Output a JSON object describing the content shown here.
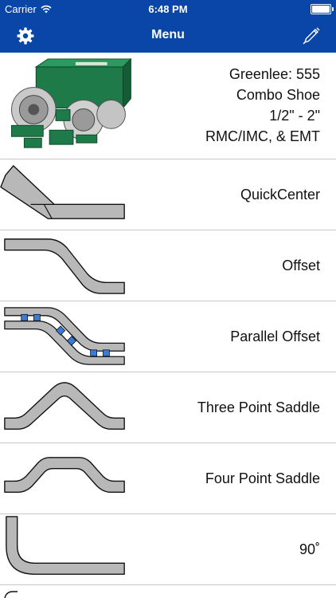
{
  "status_bar": {
    "carrier": "Carrier",
    "time": "6:48 PM"
  },
  "nav": {
    "title": "Menu"
  },
  "product": {
    "line1": "Greenlee: 555",
    "line2": "Combo Shoe",
    "line3": "1/2\" - 2\"",
    "line4": "RMC/IMC, & EMT"
  },
  "menu_items": [
    {
      "label": "QuickCenter"
    },
    {
      "label": "Offset"
    },
    {
      "label": "Parallel Offset"
    },
    {
      "label": "Three Point Saddle"
    },
    {
      "label": "Four Point Saddle"
    },
    {
      "label": "90˚"
    }
  ],
  "colors": {
    "nav_blue": "#0a46a8",
    "pipe_gray": "#b8b8b8",
    "marker_blue": "#3a7bd5",
    "bender_green": "#1f7a4a"
  }
}
